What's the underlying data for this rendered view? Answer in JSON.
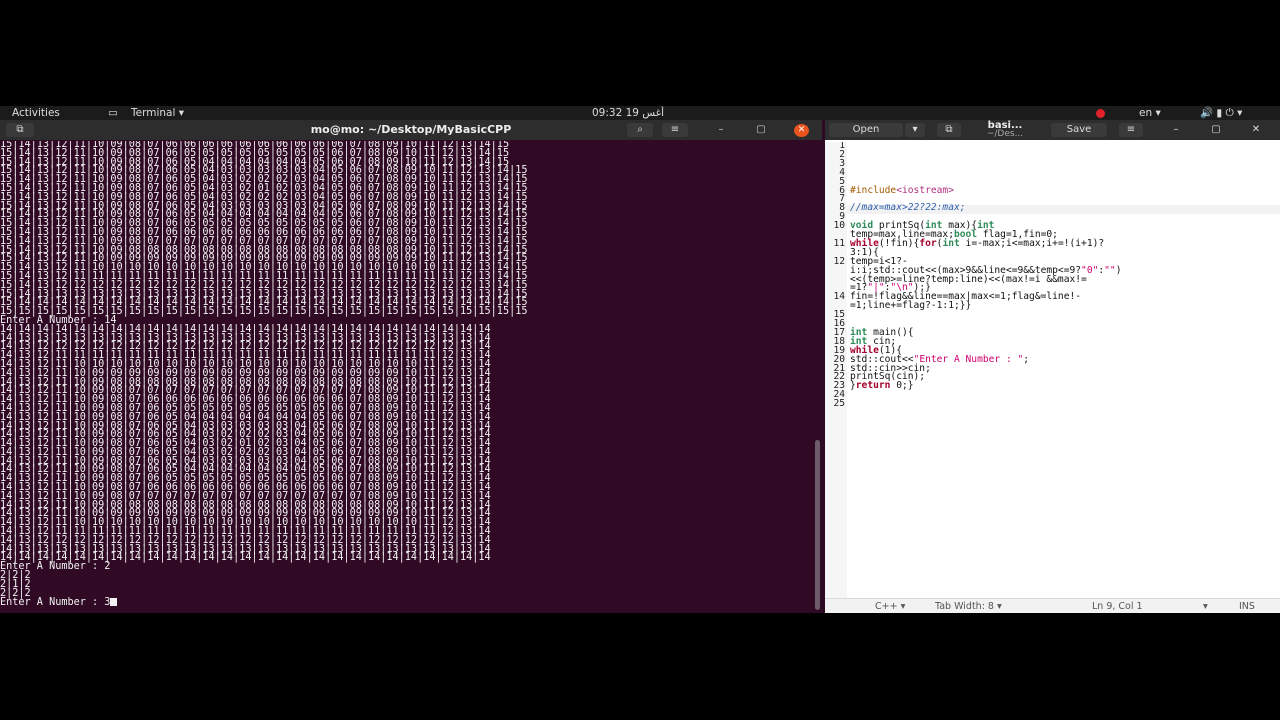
{
  "topbar": {
    "activities": "Activities",
    "app": "Terminal ▾",
    "clock": "09:32  19 أغس",
    "lang": "en ▾",
    "status_icons": "🔊  ▮  ⏻ ▾"
  },
  "terminal": {
    "title": "mo@mo: ~/Desktop/MyBasicCPP",
    "search_icon": "search-icon",
    "menu_icon": "hamburger-icon",
    "minimize": "–",
    "maximize": "▢",
    "close": "✕",
    "lines": [
      "15|14|13|12|11|10|09|08|07|06|06|06|06|06|06|06|06|06|06|07|08|09|10|11|12|13|14|15",
      "15|14|13|12|11|10|09|08|07|06|05|05|05|05|05|05|05|05|06|07|08|09|10|11|12|13|14|15",
      "15|14|13|12|11|10|09|08|07|06|05|04|04|04|04|04|04|05|06|07|08|09|10|11|12|13|14|15",
      "15|14|13|12|11|10|09|08|07|06|05|04|03|03|03|03|03|04|05|06|07|08|09|10|11|12|13|14|15",
      "15|14|13|12|11|10|09|08|07|06|05|04|03|02|02|02|03|04|05|06|07|08|09|10|11|12|13|14|15",
      "15|14|13|12|11|10|09|08|07|06|05|04|03|02|01|02|03|04|05|06|07|08|09|10|11|12|13|14|15",
      "15|14|13|12|11|10|09|08|07|06|05|04|03|02|02|02|03|04|05|06|07|08|09|10|11|12|13|14|15",
      "15|14|13|12|11|10|09|08|07|06|05|04|03|03|03|03|03|04|05|06|07|08|09|10|11|12|13|14|15",
      "15|14|13|12|11|10|09|08|07|06|05|04|04|04|04|04|04|04|05|06|07|08|09|10|11|12|13|14|15",
      "15|14|13|12|11|10|09|08|07|06|05|05|05|05|05|05|05|05|05|06|07|08|09|10|11|12|13|14|15",
      "15|14|13|12|11|10|09|08|07|06|06|06|06|06|06|06|06|06|06|06|07|08|09|10|11|12|13|14|15",
      "15|14|13|12|11|10|09|08|07|07|07|07|07|07|07|07|07|07|07|07|07|08|09|10|11|12|13|14|15",
      "15|14|13|12|11|10|09|08|08|08|08|08|08|08|08|08|08|08|08|08|08|08|09|10|11|12|13|14|15",
      "15|14|13|12|11|10|09|09|09|09|09|09|09|09|09|09|09|09|09|09|09|09|09|10|11|12|13|14|15",
      "15|14|13|12|11|10|10|10|10|10|10|10|10|10|10|10|10|10|10|10|10|10|10|10|11|12|13|14|15",
      "15|14|13|12|11|11|11|11|11|11|11|11|11|11|11|11|11|11|11|11|11|11|11|11|11|12|13|14|15",
      "15|14|13|12|12|12|12|12|12|12|12|12|12|12|12|12|12|12|12|12|12|12|12|12|12|12|13|14|15",
      "15|14|13|13|13|13|13|13|13|13|13|13|13|13|13|13|13|13|13|13|13|13|13|13|13|13|13|14|15",
      "15|14|14|14|14|14|14|14|14|14|14|14|14|14|14|14|14|14|14|14|14|14|14|14|14|14|14|14|15",
      "15|15|15|15|15|15|15|15|15|15|15|15|15|15|15|15|15|15|15|15|15|15|15|15|15|15|15|15|15",
      "Enter A Number : 14",
      "14|14|14|14|14|14|14|14|14|14|14|14|14|14|14|14|14|14|14|14|14|14|14|14|14|14|14",
      "14|13|13|13|13|13|13|13|13|13|13|13|13|13|13|13|13|13|13|13|13|13|13|13|13|13|14",
      "14|13|12|12|12|12|12|12|12|12|12|12|12|12|12|12|12|12|12|12|12|12|12|12|12|13|14",
      "14|13|12|11|11|11|11|11|11|11|11|11|11|11|11|11|11|11|11|11|11|11|11|11|12|13|14",
      "14|13|12|11|10|10|10|10|10|10|10|10|10|10|10|10|10|10|10|10|10|10|10|11|12|13|14",
      "14|13|12|11|10|09|09|09|09|09|09|09|09|09|09|09|09|09|09|09|09|09|10|11|12|13|14",
      "14|13|12|11|10|09|08|08|08|08|08|08|08|08|08|08|08|08|08|08|08|09|10|11|12|13|14",
      "14|13|12|11|10|09|08|07|07|07|07|07|07|07|07|07|07|07|07|07|08|09|10|11|12|13|14",
      "14|13|12|11|10|09|08|07|06|06|06|06|06|06|06|06|06|06|06|07|08|09|10|11|12|13|14",
      "14|13|12|11|10|09|08|07|06|05|05|05|05|05|05|05|05|05|06|07|08|09|10|11|12|13|14",
      "14|13|12|11|10|09|08|07|06|05|04|04|04|04|04|04|04|05|06|07|08|09|10|11|12|13|14",
      "14|13|12|11|10|09|08|07|06|05|04|03|03|03|03|03|04|05|06|07|08|09|10|11|12|13|14",
      "14|13|12|11|10|09|08|07|06|05|04|03|02|02|02|03|04|05|06|07|08|09|10|11|12|13|14",
      "14|13|12|11|10|09|08|07|06|05|04|03|02|01|02|03|04|05|06|07|08|09|10|11|12|13|14",
      "14|13|12|11|10|09|08|07|06|05|04|03|02|02|02|03|04|05|06|07|08|09|10|11|12|13|14",
      "14|13|12|11|10|09|08|07|06|05|04|03|03|03|03|03|04|05|06|07|08|09|10|11|12|13|14",
      "14|13|12|11|10|09|08|07|06|05|04|04|04|04|04|04|04|05|06|07|08|09|10|11|12|13|14",
      "14|13|12|11|10|09|08|07|06|05|05|05|05|05|05|05|05|05|06|07|08|09|10|11|12|13|14",
      "14|13|12|11|10|09|08|07|06|06|06|06|06|06|06|06|06|06|06|07|08|09|10|11|12|13|14",
      "14|13|12|11|10|09|08|07|07|07|07|07|07|07|07|07|07|07|07|07|08|09|10|11|12|13|14",
      "14|13|12|11|10|09|08|08|08|08|08|08|08|08|08|08|08|08|08|08|08|09|10|11|12|13|14",
      "14|13|12|11|10|09|09|09|09|09|09|09|09|09|09|09|09|09|09|09|09|09|10|11|12|13|14",
      "14|13|12|11|10|10|10|10|10|10|10|10|10|10|10|10|10|10|10|10|10|10|10|11|12|13|14",
      "14|13|12|11|11|11|11|11|11|11|11|11|11|11|11|11|11|11|11|11|11|11|11|11|12|13|14",
      "14|13|12|12|12|12|12|12|12|12|12|12|12|12|12|12|12|12|12|12|12|12|12|12|12|13|14",
      "14|13|13|13|13|13|13|13|13|13|13|13|13|13|13|13|13|13|13|13|13|13|13|13|13|13|14",
      "14|14|14|14|14|14|14|14|14|14|14|14|14|14|14|14|14|14|14|14|14|14|14|14|14|14|14",
      "Enter A Number : 2",
      "2|2|2",
      "2|1|2",
      "2|2|2"
    ],
    "prompt": "Enter A Number : 3"
  },
  "gedit": {
    "open": "Open",
    "filename": "basi...",
    "path": "~/Des...",
    "save": "Save",
    "code": [
      {
        "n": "1",
        "t": ""
      },
      {
        "n": "2",
        "t": ""
      },
      {
        "n": "3",
        "t": ""
      },
      {
        "n": "4",
        "t": ""
      },
      {
        "n": "5",
        "t": ""
      },
      {
        "n": "6",
        "t": "#include<iostream>"
      },
      {
        "n": "7",
        "t": ""
      },
      {
        "n": "8",
        "t": "//max=max>22?22:max;"
      },
      {
        "n": "9",
        "t": ""
      },
      {
        "n": "10",
        "t": "void printSq(int max){int"
      },
      {
        "n": "",
        "t": "temp=max,line=max;bool flag=1,fin=0;"
      },
      {
        "n": "11",
        "t": "while(!fin){for(int i=-max;i<=max;i+=!(i+1)?"
      },
      {
        "n": "",
        "t": "3:1){"
      },
      {
        "n": "12",
        "t": "temp=i<1?-"
      },
      {
        "n": "",
        "t": "i:i;std::cout<<(max>9&&line<=9&&temp<=9?\"0\":\"\")"
      },
      {
        "n": "",
        "t": "<<(temp>=line?temp:line)<<(max!=i &&max!="
      },
      {
        "n": "",
        "t": "=1?\"|\":\"\\n\");}"
      },
      {
        "n": "14",
        "t": "fin=!flag&&line==max|max<=1;flag&=line!-"
      },
      {
        "n": "",
        "t": "=1;line+=flag?-1:1;}}"
      },
      {
        "n": "15",
        "t": ""
      },
      {
        "n": "16",
        "t": ""
      },
      {
        "n": "17",
        "t": "int main(){"
      },
      {
        "n": "18",
        "t": "int cin;"
      },
      {
        "n": "19",
        "t": "while(1){"
      },
      {
        "n": "20",
        "t": "std::cout<<\"Enter A Number : \";"
      },
      {
        "n": "21",
        "t": "std::cin>>cin;"
      },
      {
        "n": "22",
        "t": "printSq(cin);"
      },
      {
        "n": "23",
        "t": "}return 0;}"
      },
      {
        "n": "24",
        "t": ""
      },
      {
        "n": "25",
        "t": ""
      }
    ],
    "status": {
      "lang": "C++ ▾",
      "tab": "Tab Width: 8 ▾",
      "pos": "Ln 9, Col 1",
      "mode": "INS"
    }
  }
}
